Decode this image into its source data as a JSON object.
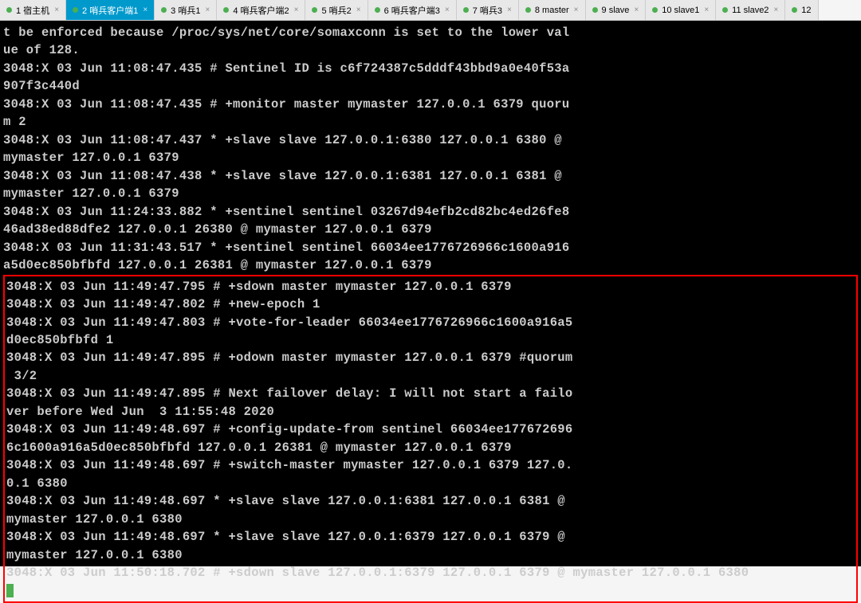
{
  "tabs": [
    {
      "label": "1 宿主机",
      "active": false
    },
    {
      "label": "2 哨兵客户端1",
      "active": true
    },
    {
      "label": "3 哨兵1",
      "active": false
    },
    {
      "label": "4 哨兵客户端2",
      "active": false
    },
    {
      "label": "5 哨兵2",
      "active": false
    },
    {
      "label": "6 哨兵客户端3",
      "active": false
    },
    {
      "label": "7 哨兵3",
      "active": false
    },
    {
      "label": "8 master",
      "active": false
    },
    {
      "label": "9 slave",
      "active": false
    },
    {
      "label": "10 slave1",
      "active": false
    },
    {
      "label": "11 slave2",
      "active": false
    },
    {
      "label": "12",
      "active": false
    }
  ],
  "terminal": {
    "top_lines": [
      "t be enforced because /proc/sys/net/core/somaxconn is set to the lower val",
      "ue of 128.",
      "3048:X 03 Jun 11:08:47.435 # Sentinel ID is c6f724387c5dddf43bbd9a0e40f53a",
      "907f3c440d",
      "3048:X 03 Jun 11:08:47.435 # +monitor master mymaster 127.0.0.1 6379 quoru",
      "m 2",
      "3048:X 03 Jun 11:08:47.437 * +slave slave 127.0.0.1:6380 127.0.0.1 6380 @ ",
      "mymaster 127.0.0.1 6379",
      "3048:X 03 Jun 11:08:47.438 * +slave slave 127.0.0.1:6381 127.0.0.1 6381 @ ",
      "mymaster 127.0.0.1 6379",
      "3048:X 03 Jun 11:24:33.882 * +sentinel sentinel 03267d94efb2cd82bc4ed26fe8",
      "46ad38ed88dfe2 127.0.0.1 26380 @ mymaster 127.0.0.1 6379",
      "3048:X 03 Jun 11:31:43.517 * +sentinel sentinel 66034ee1776726966c1600a916",
      "a5d0ec850bfbfd 127.0.0.1 26381 @ mymaster 127.0.0.1 6379"
    ],
    "highlight_lines": [
      "3048:X 03 Jun 11:49:47.795 # +sdown master mymaster 127.0.0.1 6379",
      "3048:X 03 Jun 11:49:47.802 # +new-epoch 1",
      "3048:X 03 Jun 11:49:47.803 # +vote-for-leader 66034ee1776726966c1600a916a5",
      "d0ec850bfbfd 1",
      "3048:X 03 Jun 11:49:47.895 # +odown master mymaster 127.0.0.1 6379 #quorum",
      " 3/2",
      "3048:X 03 Jun 11:49:47.895 # Next failover delay: I will not start a failo",
      "ver before Wed Jun  3 11:55:48 2020",
      "3048:X 03 Jun 11:49:48.697 # +config-update-from sentinel 66034ee177672696",
      "6c1600a916a5d0ec850bfbfd 127.0.0.1 26381 @ mymaster 127.0.0.1 6379",
      "3048:X 03 Jun 11:49:48.697 # +switch-master mymaster 127.0.0.1 6379 127.0.",
      "0.1 6380",
      "3048:X 03 Jun 11:49:48.697 * +slave slave 127.0.0.1:6381 127.0.0.1 6381 @ ",
      "mymaster 127.0.0.1 6380",
      "3048:X 03 Jun 11:49:48.697 * +slave slave 127.0.0.1:6379 127.0.0.1 6379 @ ",
      "mymaster 127.0.0.1 6380",
      "3048:X 03 Jun 11:50:18.702 # +sdown slave 127.0.0.1:6379 127.0.0.1 6379 @ mymaster 127.0.0.1 6380"
    ]
  }
}
